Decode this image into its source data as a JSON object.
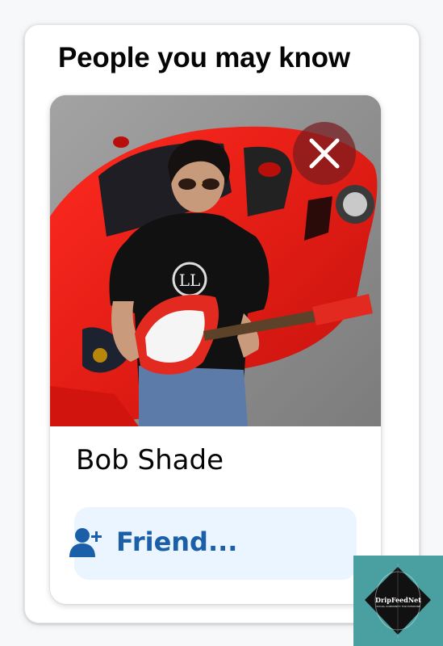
{
  "section": {
    "title": "People you may know"
  },
  "suggestion": {
    "name": "Bob Shade",
    "photo_alt": "profile-photo",
    "friend_button_label": "Friend...",
    "dismiss_icon": "close-icon",
    "friend_icon": "add-friend-icon"
  },
  "watermark": {
    "title": "DripFeedNet",
    "subtitle": "SOCIAL COMMUNITY FOR EVERYONE"
  },
  "colors": {
    "accent_text": "#1a5fa8",
    "friend_button_bg": "#ebf5ff",
    "dismiss_bg": "#781c1e",
    "watermark_bg": "#4a9fa0"
  }
}
